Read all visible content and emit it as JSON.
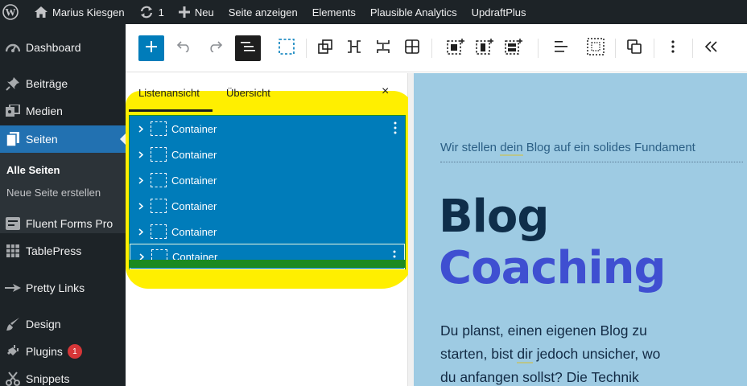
{
  "adminbar": {
    "site_name": "Marius Kiesgen",
    "updates_count": "1",
    "new_label": "Neu",
    "view_page_label": "Seite anzeigen",
    "elements_label": "Elements",
    "analytics_label": "Plausible Analytics",
    "updraft_label": "UpdraftPlus"
  },
  "sidebar": {
    "items": [
      {
        "label": "Dashboard",
        "icon": "dashboard-icon"
      },
      {
        "label": "Beiträge",
        "icon": "pin-icon"
      },
      {
        "label": "Medien",
        "icon": "media-icon"
      },
      {
        "label": "Seiten",
        "icon": "pages-icon"
      },
      {
        "label": "Fluent Forms Pro",
        "icon": "forms-icon"
      },
      {
        "label": "TablePress",
        "icon": "table-icon"
      },
      {
        "label": "Pretty Links",
        "icon": "star-icon"
      },
      {
        "label": "Design",
        "icon": "brush-icon"
      },
      {
        "label": "Plugins",
        "icon": "plugin-icon",
        "badge": "1"
      },
      {
        "label": "Snippets",
        "icon": "snippets-icon"
      }
    ],
    "submenu": {
      "current": "Alle Seiten",
      "add_new": "Neue Seite erstellen"
    }
  },
  "panel": {
    "tab_list": "Listenansicht",
    "tab_outline": "Übersicht",
    "close_label": "×",
    "rows": [
      {
        "label": "Container"
      },
      {
        "label": "Container"
      },
      {
        "label": "Container"
      },
      {
        "label": "Container"
      },
      {
        "label": "Container"
      },
      {
        "label": "Container"
      }
    ]
  },
  "canvas": {
    "tagline_pre": "Wir stellen ",
    "tagline_ul": "dein",
    "tagline_post": " Blog auf ein solides Fundament",
    "heading_line1": "Blog",
    "heading_line2": "Coaching",
    "para_line1": "Du planst, einen eigenen Blog zu",
    "para_line2_pre": "starten, bist ",
    "para_line2_ul": "dir",
    "para_line2_post": " jedoch unsicher, wo",
    "para_line3": "du anfangen sollst? Die Technik"
  },
  "colors": {
    "admin_dark": "#1d2327",
    "wp_blue": "#2271b1",
    "block_blue": "#007cba",
    "highlight_yellow": "#ffef00",
    "canvas_bg": "#9ecbe3",
    "heading_dark": "#0f2e4a",
    "heading_accent": "#3f4fd1"
  }
}
